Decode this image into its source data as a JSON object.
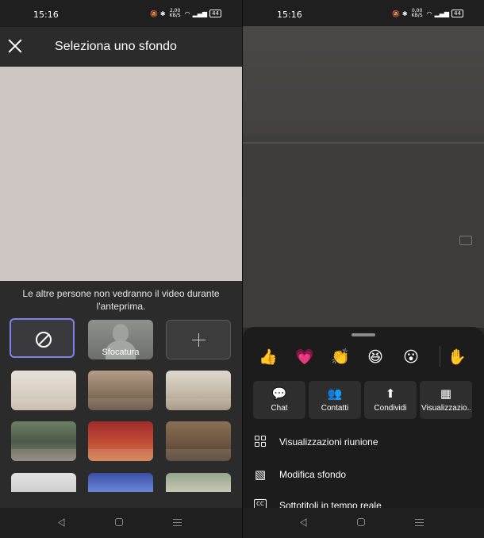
{
  "status_bar": {
    "time": "15:16",
    "network_speed_left": "2,00 KB/S",
    "network_speed_right": "0,00 KB/S",
    "battery": "44"
  },
  "background_picker": {
    "title": "Seleziona uno sfondo",
    "preview_note": "Le altre persone non vedranno il video durante l'anteprima.",
    "blur_label": "Sfocatura",
    "colors": {
      "accent": "#7b83eb",
      "panel": "#2b2b2b",
      "preview": "#cec6c3"
    }
  },
  "meeting": {
    "reactions": [
      {
        "name": "thumbs-up",
        "glyph": "👍"
      },
      {
        "name": "heart",
        "glyph": "💗"
      },
      {
        "name": "clap",
        "glyph": "👏"
      },
      {
        "name": "laugh",
        "glyph": "😆"
      },
      {
        "name": "surprised",
        "glyph": "😮"
      },
      {
        "name": "raise-hand",
        "glyph": "✋"
      }
    ],
    "actions": [
      {
        "label": "Chat",
        "icon": "chat-icon"
      },
      {
        "label": "Contatti",
        "icon": "people-icon"
      },
      {
        "label": "Condividi",
        "icon": "share-icon"
      },
      {
        "label": "Visualizzazio...",
        "icon": "view-icon"
      }
    ],
    "menu": [
      {
        "label": "Visualizzazioni riunione",
        "icon": "layout-icon"
      },
      {
        "label": "Modifica sfondo",
        "icon": "background-icon"
      },
      {
        "label": "Sottotitoli in tempo reale",
        "icon": "captions-icon"
      }
    ],
    "colors": {
      "sheet": "#1c1c1c",
      "button": "#2e2e2e"
    }
  }
}
